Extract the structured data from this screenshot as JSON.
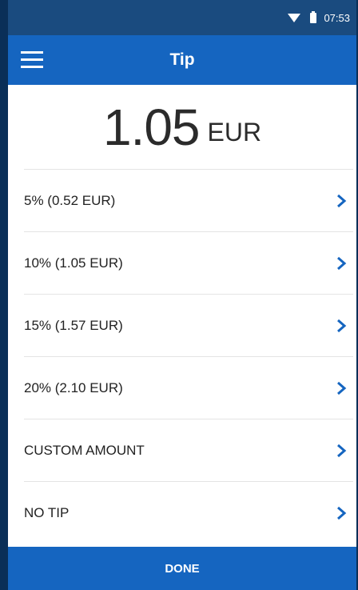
{
  "status_bar": {
    "time": "07:53",
    "wifi_icon": "wifi-icon",
    "battery_icon": "battery-icon"
  },
  "header": {
    "title": "Tip",
    "menu_icon": "menu-icon"
  },
  "amount": {
    "value": "1.05",
    "currency": "EUR"
  },
  "options": [
    {
      "label": "5% (0.52 EUR)"
    },
    {
      "label": "10% (1.05 EUR)"
    },
    {
      "label": "15% (1.57 EUR)"
    },
    {
      "label": "20% (2.10 EUR)"
    },
    {
      "label": "CUSTOM AMOUNT"
    },
    {
      "label": "NO TIP"
    }
  ],
  "footer": {
    "done_label": "DONE"
  },
  "colors": {
    "primary": "#1565c0",
    "status_bar": "#1a4b7f",
    "chevron": "#1565c0"
  }
}
